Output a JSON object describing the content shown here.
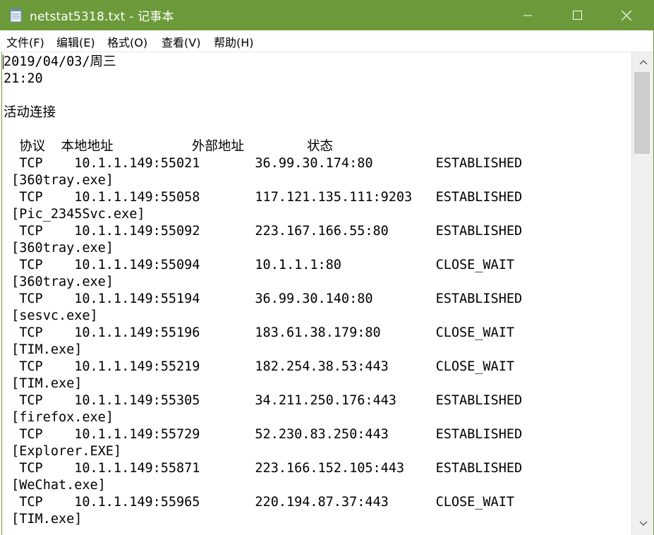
{
  "window": {
    "title": "netstat5318.txt - 记事本",
    "accent": "#6c9a3a",
    "icons": {
      "app": "notepad-icon",
      "minimize": "minimize-icon",
      "maximize": "maximize-icon",
      "close": "close-icon"
    }
  },
  "menu": {
    "file": "文件(F)",
    "edit": "编辑(E)",
    "format": "格式(O)",
    "view": "查看(V)",
    "help": "帮助(H)"
  },
  "document": {
    "lines": [
      "2019/04/03/周三",
      "21:20",
      "",
      "活动连接",
      "",
      "  协议  本地地址          外部地址        状态",
      "  TCP    10.1.1.149:55021       36.99.30.174:80        ESTABLISHED",
      " [360tray.exe]",
      "  TCP    10.1.1.149:55058       117.121.135.111:9203   ESTABLISHED",
      " [Pic_2345Svc.exe]",
      "  TCP    10.1.1.149:55092       223.167.166.55:80      ESTABLISHED",
      " [360tray.exe]",
      "  TCP    10.1.1.149:55094       10.1.1.1:80            CLOSE_WAIT",
      " [360tray.exe]",
      "  TCP    10.1.1.149:55194       36.99.30.140:80        ESTABLISHED",
      " [sesvc.exe]",
      "  TCP    10.1.1.149:55196       183.61.38.179:80       CLOSE_WAIT",
      " [TIM.exe]",
      "  TCP    10.1.1.149:55219       182.254.38.53:443      CLOSE_WAIT",
      " [TIM.exe]",
      "  TCP    10.1.1.149:55305       34.211.250.176:443     ESTABLISHED",
      " [firefox.exe]",
      "  TCP    10.1.1.149:55729       52.230.83.250:443      ESTABLISHED",
      " [Explorer.EXE]",
      "  TCP    10.1.1.149:55871       223.166.152.105:443    ESTABLISHED",
      " [WeChat.exe]",
      "  TCP    10.1.1.149:55965       220.194.87.37:443      CLOSE_WAIT",
      " [TIM.exe]"
    ]
  },
  "scrollbar": {
    "up_icon": "chevron-up-icon",
    "down_icon": "chevron-down-icon"
  }
}
